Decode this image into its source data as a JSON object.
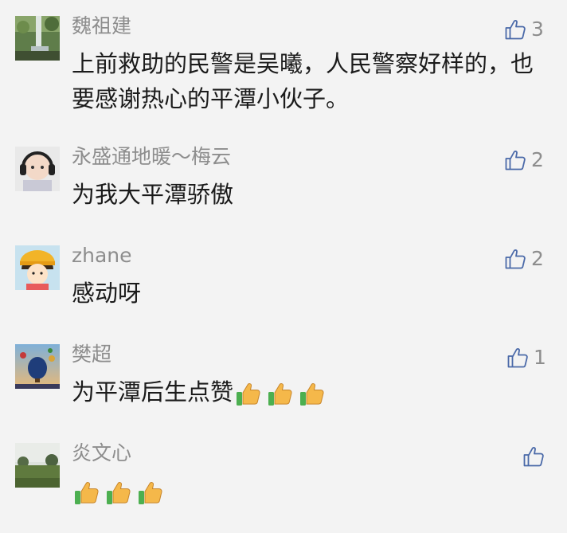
{
  "comments": [
    {
      "author": "魏祖建",
      "likes": "3",
      "lines": [
        "上前救助的民警是吴曦，人民警察好样的，也",
        "要感谢热心的平潭小伙子。"
      ],
      "avatar": "waterfall-avatar"
    },
    {
      "author": "永盛通地暖～梅云",
      "likes": "2",
      "lines": [
        "为我大平潭骄傲"
      ],
      "avatar": "baby-headphones-avatar"
    },
    {
      "author": "zhane",
      "likes": "2",
      "lines": [
        "感动呀"
      ],
      "avatar": "cartoon-girl-avatar"
    },
    {
      "author": "樊超",
      "likes": "1",
      "lines": [
        "为平潭后生点赞"
      ],
      "emoji_count": 3,
      "avatar": "hot-air-balloon-avatar"
    },
    {
      "author": "炎文心",
      "likes": "",
      "lines": [],
      "emoji_count": 3,
      "avatar": "grass-field-avatar"
    }
  ],
  "colors": {
    "background": "#f3f3f3",
    "name": "#8d8d8d",
    "text": "#1b1b1b",
    "like_icon": "#4a69a8"
  }
}
